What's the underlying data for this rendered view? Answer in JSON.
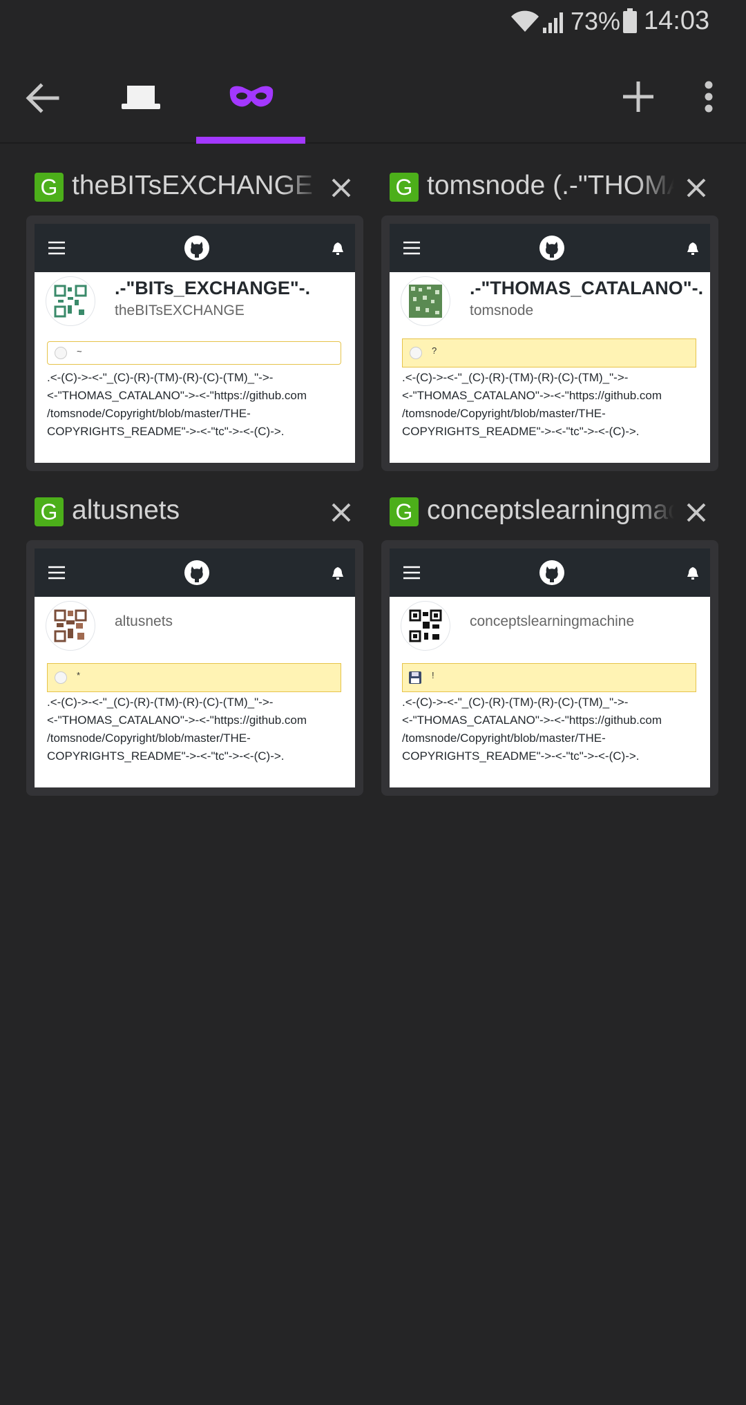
{
  "status_bar": {
    "battery_percent": "73%",
    "time": "14:03",
    "icons": [
      "wifi-icon",
      "signal-icon",
      "battery-icon"
    ]
  },
  "toolbar": {
    "icons": [
      "back-arrow-icon",
      "normal-tabs-icon",
      "private-mask-icon",
      "plus-icon",
      "more-vert-icon"
    ],
    "accent_color": "#a338ff"
  },
  "tabs": [
    {
      "favicon": "G",
      "title": "theBITsEXCHANGE (.-\"BITs_EXCHANGE\"-.)",
      "page": {
        "name": ".-\"BITs_EXCHANGE\"-.",
        "login": "theBITsEXCHANGE",
        "status_text": "~",
        "bio": [
          ".<-(C)->-<-\"_(C)-(R)-(TM)-(R)-(C)-(TM)_\"->-",
          "<-\"THOMAS_CATALANO\"->-<-\"https://github.com",
          "/tomsnode/Copyright/blob/master/THE-",
          "COPYRIGHTS_README\"->-<-\"tc\"->-<-(C)->."
        ]
      }
    },
    {
      "favicon": "G",
      "title": "tomsnode (.-\"THOMAS_CATALANO\"-.)",
      "page": {
        "name": ".-\"THOMAS_CATALANO\"-.",
        "login": "tomsnode",
        "status_text": "?",
        "bio": [
          ".<-(C)->-<-\"_(C)-(R)-(TM)-(R)-(C)-(TM)_\"->-",
          "<-\"THOMAS_CATALANO\"->-<-\"https://github.com",
          "/tomsnode/Copyright/blob/master/THE-",
          "COPYRIGHTS_README\"->-<-\"tc\"->-<-(C)->."
        ]
      }
    },
    {
      "favicon": "G",
      "title": "altusnets",
      "page": {
        "name": "",
        "login": "altusnets",
        "status_text": "*",
        "bio": [
          ".<-(C)->-<-\"_(C)-(R)-(TM)-(R)-(C)-(TM)_\"->-",
          "<-\"THOMAS_CATALANO\"->-<-\"https://github.com",
          "/tomsnode/Copyright/blob/master/THE-",
          "COPYRIGHTS_README\"->-<-\"tc\"->-<-(C)->."
        ]
      }
    },
    {
      "favicon": "G",
      "title": "conceptslearningmachine",
      "page": {
        "name": "",
        "login": "conceptslearningmachine",
        "status_text": "!",
        "bio": [
          ".<-(C)->-<-\"_(C)-(R)-(TM)-(R)-(C)-(TM)_\"->-",
          "<-\"THOMAS_CATALANO\"->-<-\"https://github.com",
          "/tomsnode/Copyright/blob/master/THE-",
          "COPYRIGHTS_README\"->-<-\"tc\"->-<-(C)->."
        ]
      }
    }
  ]
}
